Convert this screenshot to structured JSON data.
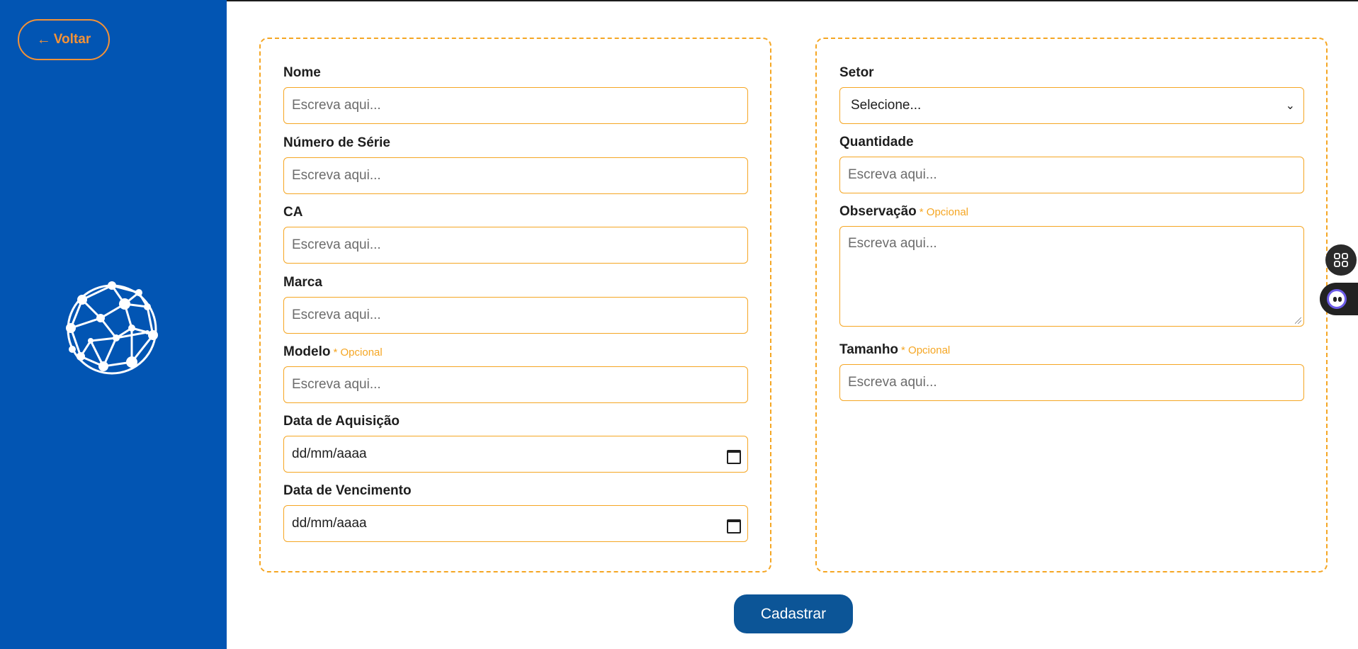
{
  "sidebar": {
    "back_label": "Voltar",
    "back_arrow": "←",
    "logo_icon": "network-globe-icon"
  },
  "form_left": {
    "nome": {
      "label": "Nome",
      "placeholder": "Escreva aqui..."
    },
    "numero_serie": {
      "label": "Número de Série",
      "placeholder": "Escreva aqui..."
    },
    "ca": {
      "label": "CA",
      "placeholder": "Escreva aqui..."
    },
    "marca": {
      "label": "Marca",
      "placeholder": "Escreva aqui..."
    },
    "modelo": {
      "label": "Modelo",
      "optional": "* Opcional",
      "placeholder": "Escreva aqui..."
    },
    "data_aquisicao": {
      "label": "Data de Aquisição",
      "value": "dd/mm/aaaa"
    },
    "data_vencimento": {
      "label": "Data de Vencimento",
      "value": "dd/mm/aaaa"
    }
  },
  "form_right": {
    "setor": {
      "label": "Setor",
      "selected": "Selecione..."
    },
    "quantidade": {
      "label": "Quantidade",
      "placeholder": "Escreva aqui..."
    },
    "observacao": {
      "label": "Observação",
      "optional": "* Opcional",
      "placeholder": "Escreva aqui..."
    },
    "tamanho": {
      "label": "Tamanho",
      "optional": "* Opcional",
      "placeholder": "Escreva aqui..."
    }
  },
  "submit_label": "Cadastrar",
  "colors": {
    "sidebar": "#0255b3",
    "accent": "#f39237",
    "border": "#f5a623",
    "button": "#0c5597"
  }
}
